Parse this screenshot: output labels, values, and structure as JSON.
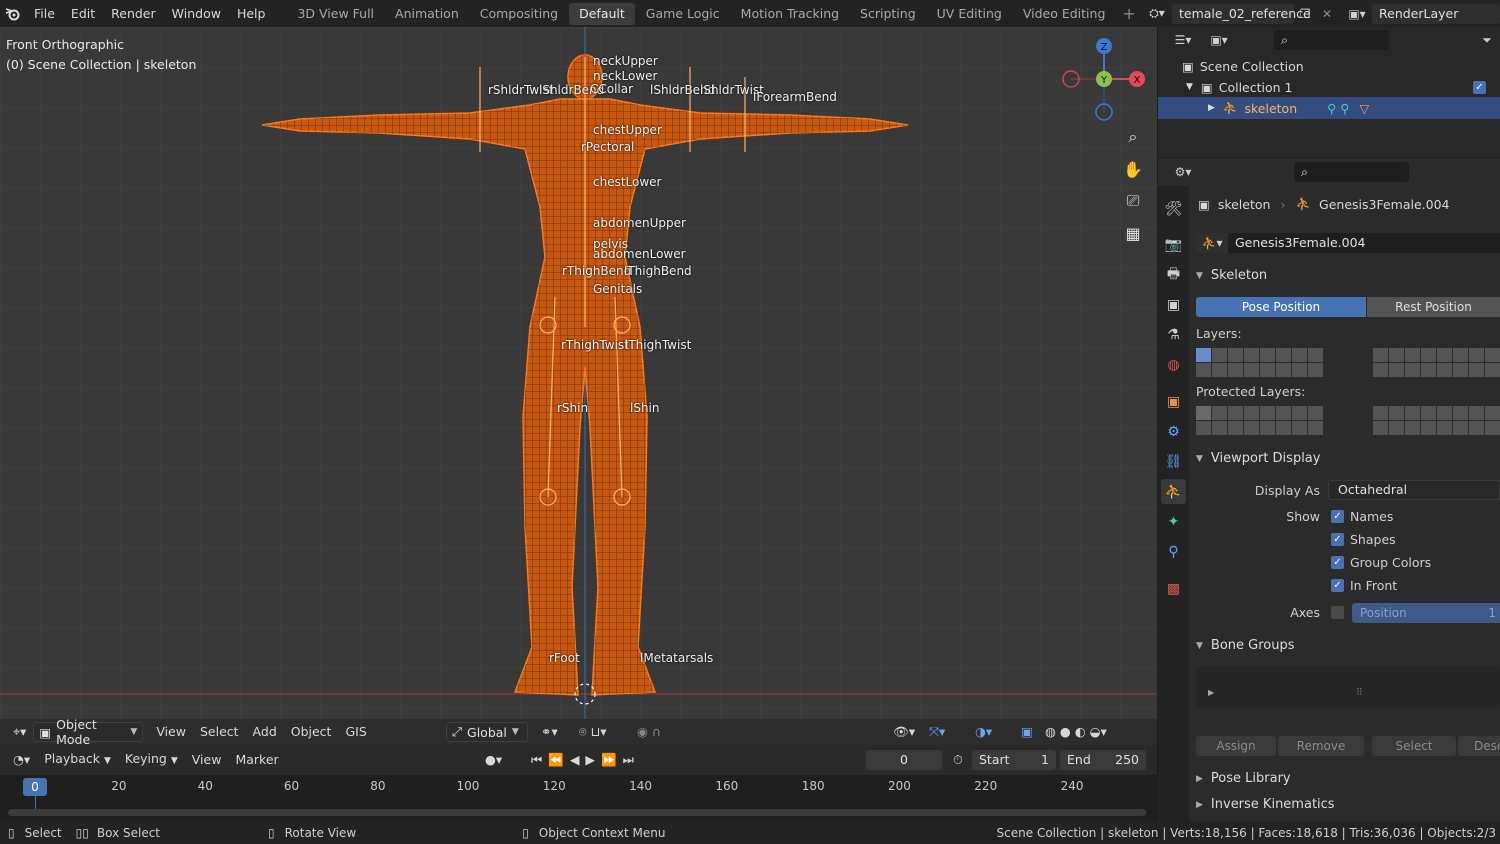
{
  "menu": [
    "File",
    "Edit",
    "Render",
    "Window",
    "Help"
  ],
  "workspaces": [
    "3D View Full",
    "Animation",
    "Compositing",
    "Default",
    "Game Logic",
    "Motion Tracking",
    "Scripting",
    "UV Editing",
    "Video Editing"
  ],
  "active_workspace": "Default",
  "scene_name": "temale_02_reference",
  "render_layer": "RenderLayer",
  "viewport": {
    "view_name": "Front Orthographic",
    "collection_info": "(0) Scene Collection | skeleton",
    "gizmo": {
      "z": "Z",
      "y": "Y",
      "x": "X"
    },
    "bones": {
      "neckUpper": "neckUpper",
      "neckLower": "neckLower",
      "rShldrTwist": "rShldrTwist",
      "lShldrBend_r": "lShldrBend",
      "cCollar": "CCollar",
      "lShldrBend": "lShldrBend",
      "lShldrTwist": "lShldrTwist",
      "lForearmBend": "lForearmBend",
      "chestUpper": "chestUpper",
      "rPectoral": "rPectoral",
      "chestLower": "chestLower",
      "abdomenUpper": "abdomenUpper",
      "pelvis": "pelvis",
      "abdomenLower": "abdomenLower",
      "rThighBend": "rThighBend",
      "lThighBend": "lThighBend",
      "genitals": "Genitals",
      "rThighTwist": "rThighTwist",
      "lThighTwist": "lThighTwist",
      "rShin": "rShin",
      "lShin": "lShin",
      "rFoot": "rFoot",
      "lMetatarsals": "lMetatarsals"
    }
  },
  "viewport_header": {
    "mode": "Object Mode",
    "menus": [
      "View",
      "Select",
      "Add",
      "Object",
      "GIS"
    ],
    "orientation": "Global"
  },
  "timeline": {
    "menus": [
      "Playback",
      "Keying",
      "View",
      "Marker"
    ],
    "current_frame": "0",
    "start_label": "Start",
    "start": "1",
    "end_label": "End",
    "end": "250",
    "ticks": [
      "0",
      "20",
      "40",
      "60",
      "80",
      "100",
      "120",
      "140",
      "160",
      "180",
      "200",
      "220",
      "240"
    ]
  },
  "statusbar": {
    "select": "Select",
    "box_select": "Box Select",
    "rotate": "Rotate View",
    "context": "Object Context Menu",
    "stats": "Scene Collection | skeleton | Verts:18,156 | Faces:18,618 | Tris:36,036 | Objects:2/3"
  },
  "outliner": {
    "scene_collection": "Scene Collection",
    "collection1": "Collection 1",
    "skeleton": "skeleton"
  },
  "properties": {
    "object_name": "skeleton",
    "armature_name": "Genesis3Female.004",
    "data_field": "Genesis3Female.004",
    "skeleton_panel": "Skeleton",
    "pose_position": "Pose Position",
    "rest_position": "Rest Position",
    "layers_label": "Layers:",
    "protected_layers_label": "Protected Layers:",
    "viewport_display": "Viewport Display",
    "display_as_label": "Display As",
    "display_as": "Octahedral",
    "show_label": "Show",
    "names": "Names",
    "shapes": "Shapes",
    "group_colors": "Group Colors",
    "in_front": "In Front",
    "axes_label": "Axes",
    "axes_value": "Position",
    "axes_num": "1",
    "bone_groups": "Bone Groups",
    "assign": "Assign",
    "remove": "Remove",
    "select": "Select",
    "deselect": "Dese",
    "pose_library": "Pose Library",
    "inverse_kinematics": "Inverse Kinematics"
  }
}
